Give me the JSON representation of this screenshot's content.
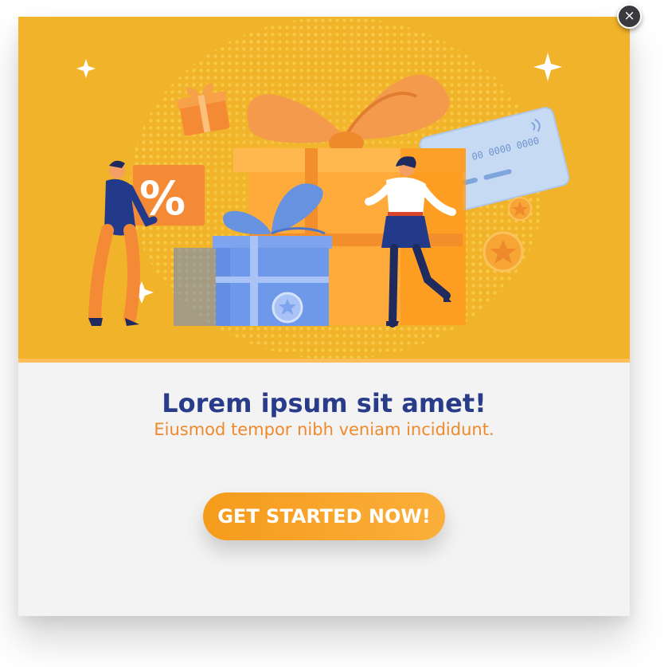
{
  "modal": {
    "close_label": "×",
    "title": "Lorem ipsum sit amet!",
    "subtitle": "Eiusmod tempor nibh veniam incididunt.",
    "cta_label": "GET STARTED NOW!"
  },
  "illustration": {
    "percent_sign": "%",
    "card_number": "00 0000 0000"
  },
  "colors": {
    "hero_background": "#f1b32a",
    "title": "#283c8a",
    "subtitle": "#ef8a2c",
    "cta": "#f7a128",
    "panel": "#f3f3f4"
  }
}
